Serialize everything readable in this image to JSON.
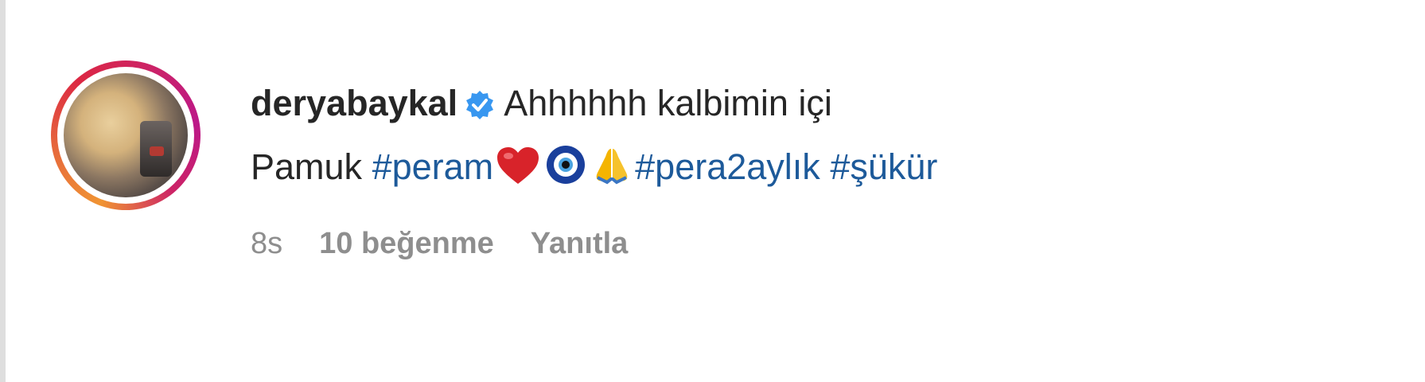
{
  "comment": {
    "username": "deryabaykal",
    "verified_icon": "verified-badge-icon",
    "text_line1": "Ahhhhhh kalbimin içi",
    "text_line2_prefix": "Pamuk ",
    "hashtags": [
      "#peram",
      "#pera2aylık",
      "#şükür"
    ],
    "emojis": [
      "red-heart-icon",
      "nazar-amulet-icon",
      "folded-hands-icon"
    ],
    "time": "8s",
    "likes": "10 beğenme",
    "reply_label": "Yanıtla"
  },
  "colors": {
    "text": "#262626",
    "hashtag": "#1d5a9a",
    "meta": "#8e8e8e",
    "verified": "#3897f0"
  }
}
